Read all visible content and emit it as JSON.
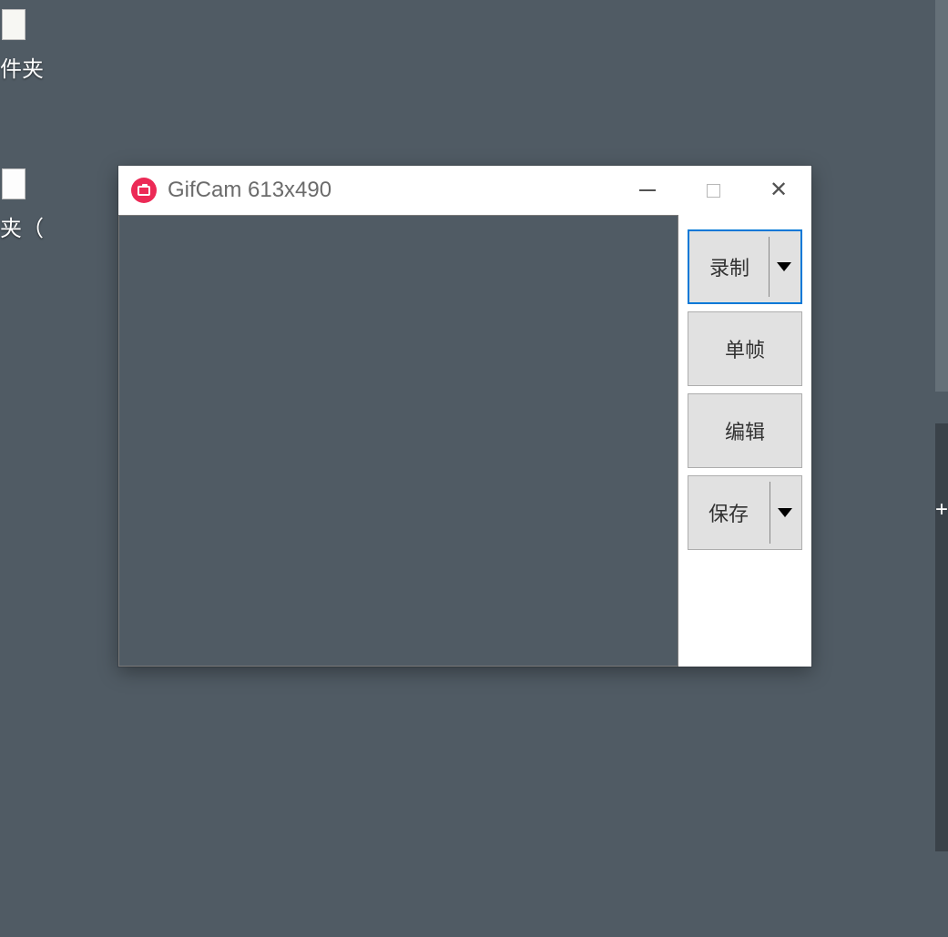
{
  "desktop": {
    "icon1_label": "件夹",
    "icon2_label": "夹（"
  },
  "window": {
    "title": "GifCam 613x490"
  },
  "buttons": {
    "record": "录制",
    "frame": "单帧",
    "edit": "编辑",
    "save": "保存"
  }
}
